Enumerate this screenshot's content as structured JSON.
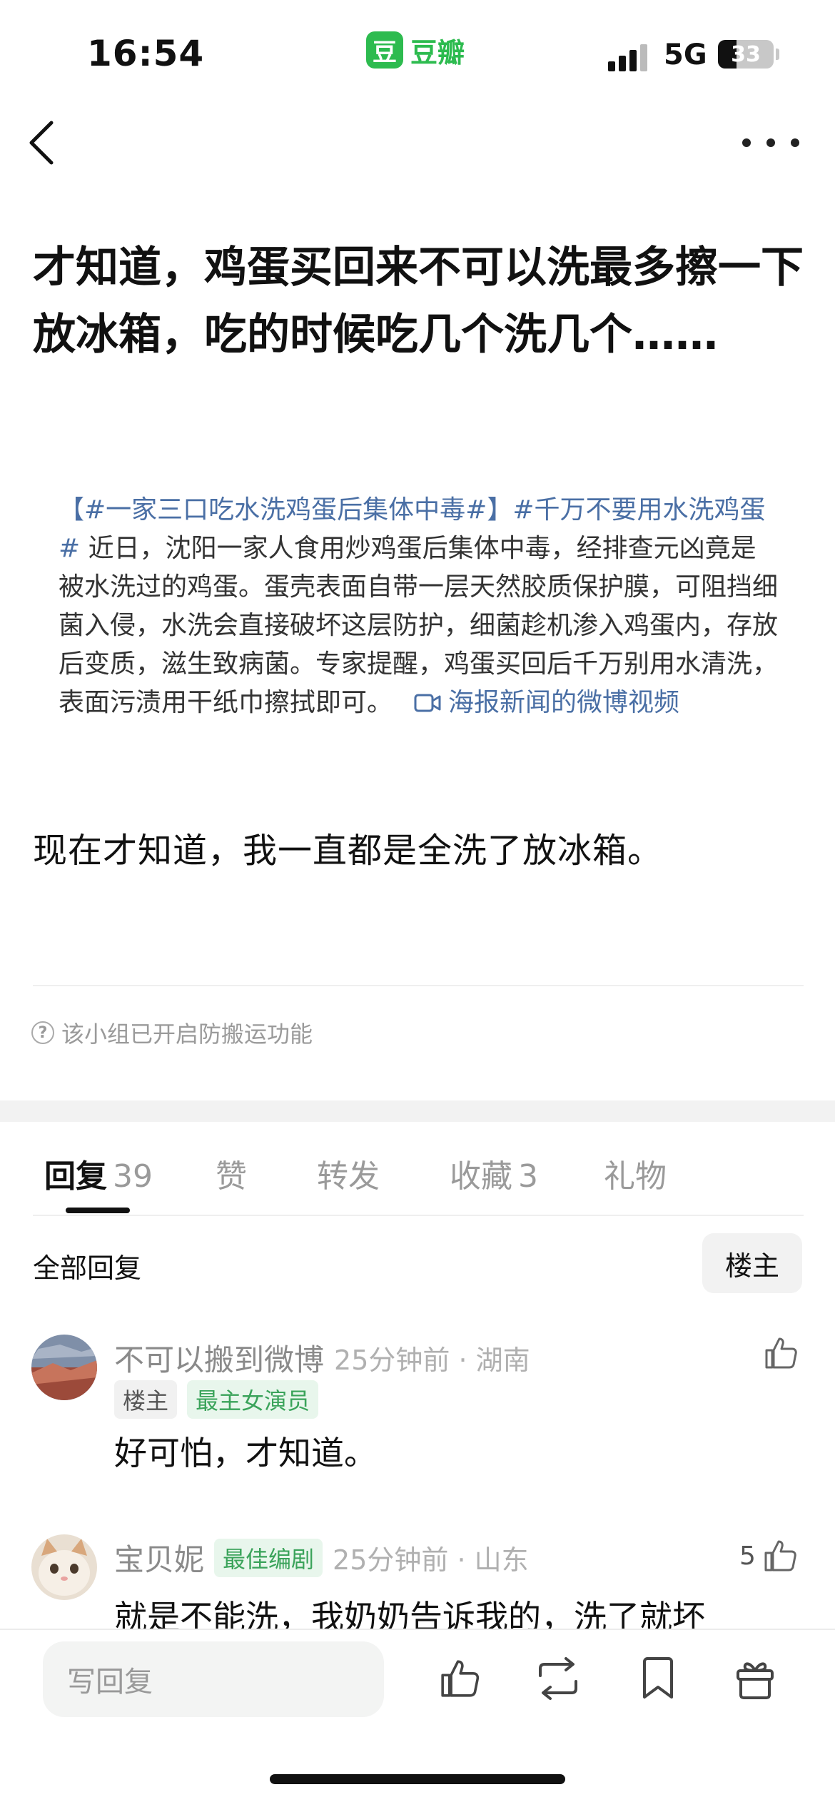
{
  "status_bar": {
    "time": "16:54",
    "app_logo_glyph": "豆",
    "app_name": "豆瓣",
    "network": "5G",
    "battery": "33",
    "battery_level": 0.33,
    "app_color": "#2dbb4f"
  },
  "nav": {
    "back_icon": "chevron-left-icon",
    "more_icon": "more-dots-icon"
  },
  "post": {
    "title": "才知道，鸡蛋买回来不可以洗最多擦一下放冰箱，吃的时候吃几个洗几个……",
    "quote": {
      "tag1": "【#一家三口吃水洗鸡蛋后集体中毒#】",
      "tag2": "#千万不要用水洗鸡蛋#",
      "text": " 近日，沈阳一家人食用炒鸡蛋后集体中毒，经排查元凶竟是被水洗过的鸡蛋。蛋壳表面自带一层天然胶质保护膜，可阻挡细菌入侵，水洗会直接破坏这层防护，细菌趁机渗入鸡蛋内，存放后变质，滋生致病菌。专家提醒，鸡蛋买回后千万别用水清洗，表面污渍用干纸巾擦拭即可。",
      "video_link": "海报新闻的微博视频",
      "link_color": "#4a6fa5"
    },
    "body": "现在才知道，我一直都是全洗了放冰箱。",
    "notice": "该小组已开启防搬运功能"
  },
  "tabs": [
    {
      "label": "回复",
      "count": "39",
      "active": true
    },
    {
      "label": "赞",
      "count": ""
    },
    {
      "label": "转发",
      "count": ""
    },
    {
      "label": "收藏",
      "count": "3"
    },
    {
      "label": "礼物",
      "count": ""
    }
  ],
  "replies_header": {
    "all_label": "全部回复",
    "op_filter": "楼主"
  },
  "comments": [
    {
      "name": "不可以搬到微博",
      "meta": "25分钟前 · 湖南",
      "badges": [
        "楼主",
        "最主女演员"
      ],
      "text": "好可怕，才知道。",
      "likes": ""
    },
    {
      "name": "宝贝妮",
      "meta": "25分钟前 · 山东",
      "badges": [
        "最佳编剧"
      ],
      "text": "就是不能洗，我奶奶告诉我的，洗了就坏",
      "likes": "5"
    }
  ],
  "bottom_bar": {
    "reply_placeholder": "写回复",
    "icons": [
      "thumbs-up-icon",
      "repost-icon",
      "bookmark-icon",
      "gift-icon"
    ]
  }
}
